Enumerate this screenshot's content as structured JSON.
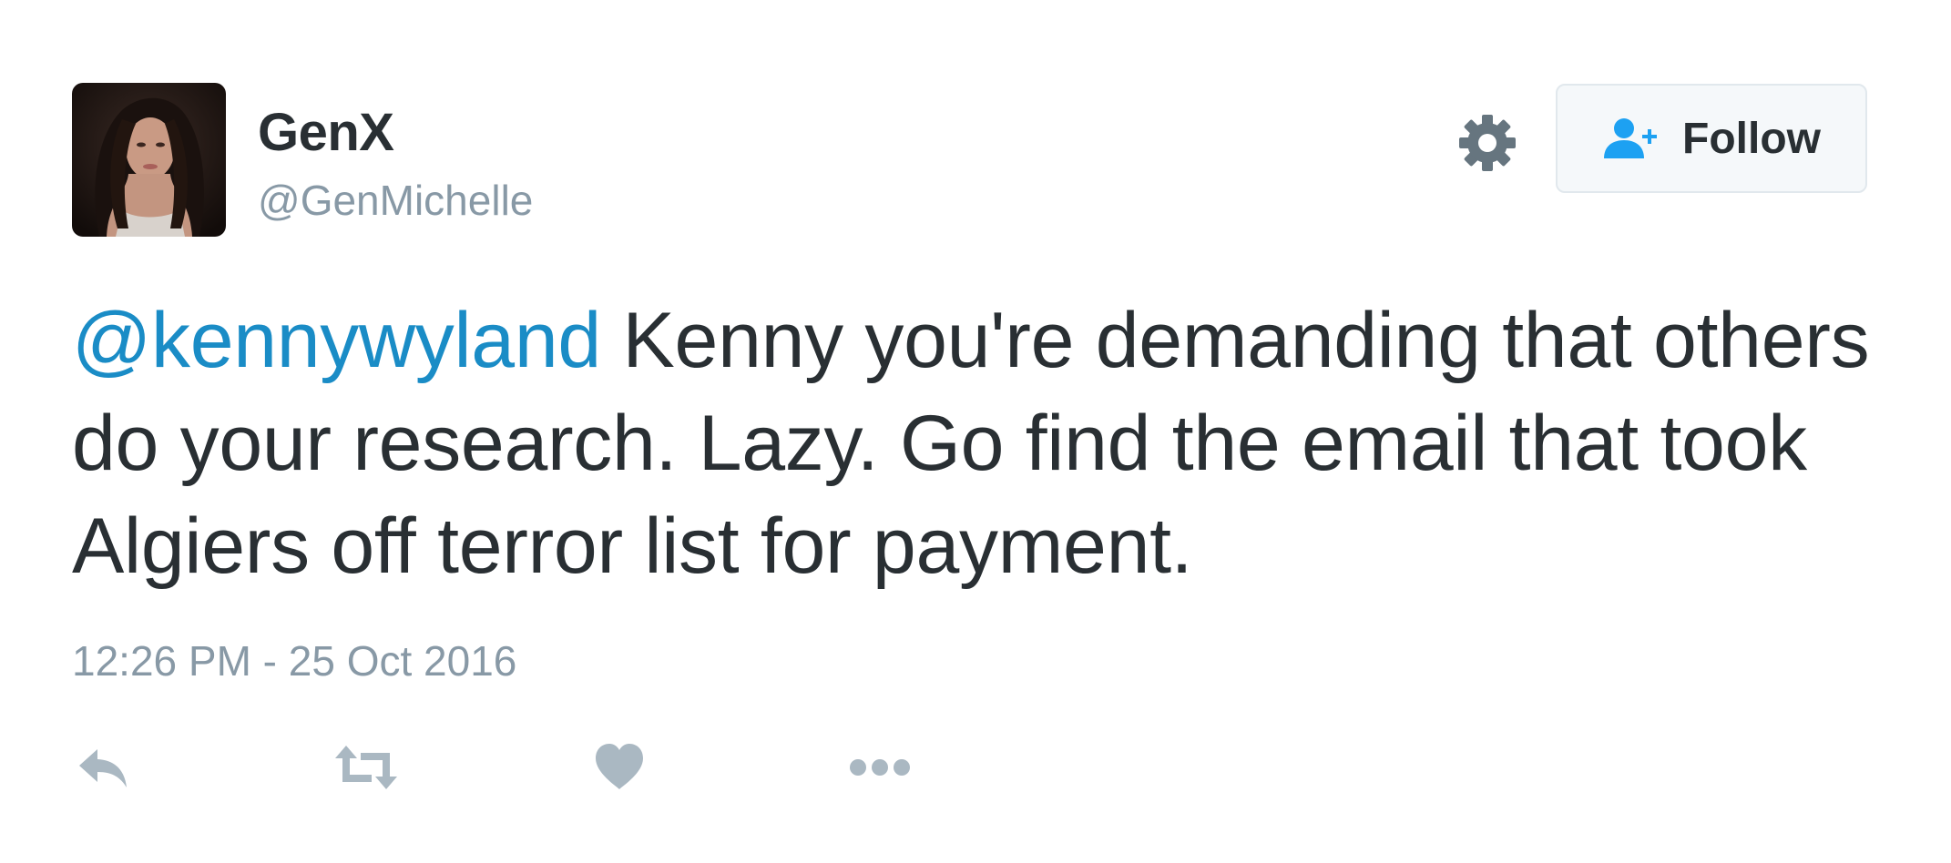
{
  "author": {
    "display_name": "GenX",
    "screen_name": "@GenMichelle",
    "avatar_icon": "profile-photo"
  },
  "header": {
    "settings_icon": "gear-icon",
    "follow_label": "Follow",
    "follow_icon": "person-add-icon"
  },
  "tweet": {
    "mention": "@kennywyland",
    "text": " Kenny you're demanding that others do your research. Lazy. Go find the email that took Algiers off terror list for payment.",
    "timestamp": "12:26 PM - 25 Oct 2016"
  },
  "actions": [
    "reply-icon",
    "retweet-icon",
    "like-icon",
    "more-icon"
  ],
  "colors": {
    "text": "#292f33",
    "muted": "#8899a6",
    "link": "#1a8cc6",
    "follow_icon": "#1da1f2",
    "action_icon": "#aab8c2",
    "button_bg": "#f5f8fa",
    "button_border": "#e1e8ed"
  }
}
